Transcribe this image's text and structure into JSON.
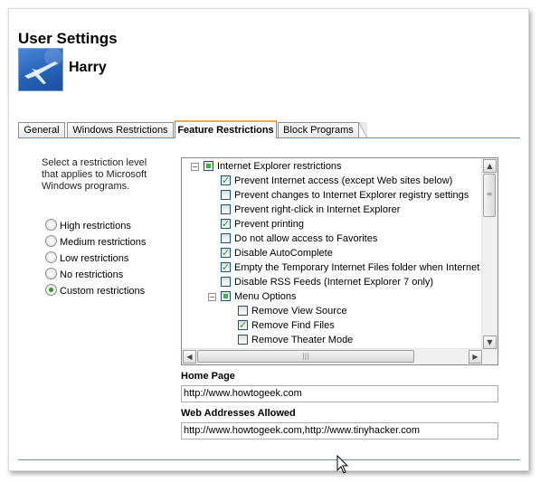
{
  "header": {
    "title": "User Settings",
    "username": "Harry"
  },
  "tabs": [
    {
      "label": "General",
      "active": false
    },
    {
      "label": "Windows Restrictions",
      "active": false
    },
    {
      "label": "Feature Restrictions",
      "active": true
    },
    {
      "label": "Block Programs",
      "active": false
    }
  ],
  "restriction": {
    "description": "Select a restriction level that applies to Microsoft Windows programs.",
    "options": [
      {
        "label": "High restrictions",
        "selected": false
      },
      {
        "label": "Medium restrictions",
        "selected": false
      },
      {
        "label": "Low restrictions",
        "selected": false
      },
      {
        "label": "No restrictions",
        "selected": false
      },
      {
        "label": "Custom restrictions",
        "selected": true
      }
    ]
  },
  "tree": {
    "root": {
      "label": "Internet Explorer restrictions",
      "state": "partial",
      "expanded": true
    },
    "items": [
      {
        "label": "Prevent Internet access (except Web sites below)",
        "checked": true
      },
      {
        "label": "Prevent changes to Internet Explorer registry settings",
        "checked": false
      },
      {
        "label": "Prevent right-click in Internet Explorer",
        "checked": false
      },
      {
        "label": "Prevent printing",
        "checked": true
      },
      {
        "label": "Do not allow access to Favorites",
        "checked": false
      },
      {
        "label": "Disable AutoComplete",
        "checked": true
      },
      {
        "label": "Empty the Temporary Internet Files folder when Internet Ex",
        "checked": true
      },
      {
        "label": "Disable RSS Feeds (Internet Explorer 7 only)",
        "checked": false
      }
    ],
    "submenu": {
      "label": "Menu Options",
      "state": "partial",
      "expanded": true
    },
    "subitems": [
      {
        "label": "Remove View Source",
        "checked": false
      },
      {
        "label": "Remove Find Files",
        "checked": true
      },
      {
        "label": "Remove Theater Mode",
        "checked": false
      }
    ]
  },
  "homepage": {
    "label": "Home Page",
    "value": "http://www.howtogeek.com"
  },
  "allowed": {
    "label": "Web Addresses Allowed",
    "value": "http://www.howtogeek.com,http://www.tinyhacker.com"
  },
  "colors": {
    "active_tab_accent": "#f1a93c",
    "separator": "#6d8fb0",
    "check": "#21a121"
  }
}
